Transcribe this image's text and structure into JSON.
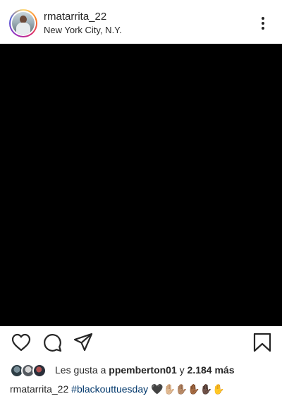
{
  "post": {
    "username": "rmatarrita_22",
    "location": "New York City, N.Y."
  },
  "likes": {
    "prefix": "Les gusta a ",
    "user": "ppemberton01",
    "connector": " y ",
    "count_text": "2.184 más"
  },
  "caption": {
    "username": "rmatarrita_22",
    "hashtag": "#blackouttuesday",
    "emojis": "🖤✋🏼✋🏽✋🏾✋🏿✋"
  },
  "icons": {
    "like": "heart-icon",
    "comment": "comment-icon",
    "share": "paper-plane-icon",
    "save": "bookmark-icon",
    "more": "more-options-icon"
  },
  "colors": {
    "hashtag": "#00376b",
    "text": "#262626",
    "image_background": "#000000"
  }
}
